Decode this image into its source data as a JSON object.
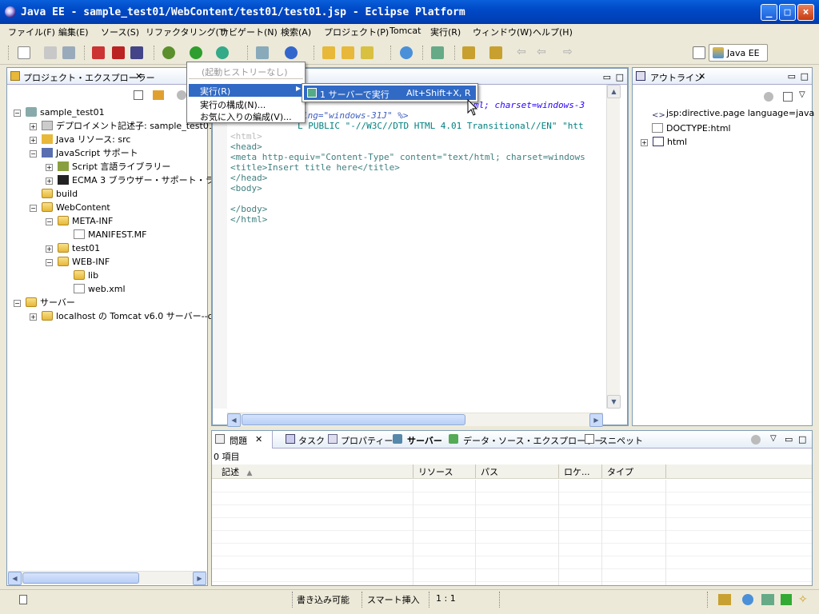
{
  "window": {
    "title": "Java EE - sample_test01/WebContent/test01/test01.jsp - Eclipse Platform"
  },
  "menubar": [
    "ファイル(F)",
    "編集(E)",
    "ソース(S)",
    "リファクタリング(T)",
    "ナビゲート(N)",
    "検索(A)",
    "プロジェクト(P)",
    "Tomcat",
    "実行(R)",
    "ウィンドウ(W)",
    "ヘルプ(H)"
  ],
  "perspective": {
    "label": "Java EE"
  },
  "explorer": {
    "title": "プロジェクト・エクスプローラー",
    "items": [
      "sample_test01",
      "デプロイメント記述子: sample_test01",
      "Java リソース: src",
      "JavaScript サポート",
      "Script 言語ライブラリー",
      "ECMA 3 ブラウザー・サポート・ライブ",
      "build",
      "WebContent",
      "META-INF",
      "MANIFEST.MF",
      "test01",
      "WEB-INF",
      "lib",
      "web.xml",
      "サーバー",
      "localhost の Tomcat v6.0 サーバー--co"
    ]
  },
  "editor": {
    "lines": [
      {
        "head": "",
        "rest": "ml; charset=windows-3"
      },
      {
        "head": "",
        "rest": "ing=\"windows-31J\" %>"
      },
      {
        "head": "",
        "rest": "L PUBLIC \"-//W3C//DTD HTML 4.01 Transitional//EN\" \"htt"
      },
      {
        "head": "",
        "rest": "<html>"
      },
      {
        "head": "",
        "rest": "<head>"
      },
      {
        "head": "",
        "rest": "<meta http-equiv=\"Content-Type\" content=\"text/html; charset=windows"
      },
      {
        "head": "",
        "rest": "<title>Insert title here</title>"
      },
      {
        "head": "",
        "rest": "</head>"
      },
      {
        "head": "",
        "rest": "<body>"
      },
      {
        "head": "",
        "rest": ""
      },
      {
        "head": "",
        "rest": "</body>"
      },
      {
        "head": "",
        "rest": "</html>"
      }
    ]
  },
  "run_menu": {
    "history": "(起動ヒストリーなし)",
    "run": "実行(R)",
    "run_config": "実行の構成(N)...",
    "favorites": "お気に入りの編成(V)..."
  },
  "submenu": {
    "item": "1 サーバーで実行",
    "shortcut": "Alt+Shift+X, R"
  },
  "outline": {
    "title": "アウトライン",
    "items": [
      "jsp:directive.page language=java",
      "DOCTYPE:html",
      "html"
    ]
  },
  "bottom": {
    "tabs": [
      "問題",
      "タスク",
      "プロパティー",
      "サーバー",
      "データ・ソース・エクスプローラー",
      "スニペット"
    ],
    "count": "0 項目",
    "columns": [
      "記述",
      "リソース",
      "パス",
      "ロケ...",
      "タイプ"
    ]
  },
  "status": {
    "writable": "書き込み可能",
    "insert": "スマート挿入",
    "pos": "1 : 1"
  },
  "colors": {
    "title_bar": "#0049c6",
    "selection": "#316ac5",
    "panel_border": "#7f9db9"
  }
}
